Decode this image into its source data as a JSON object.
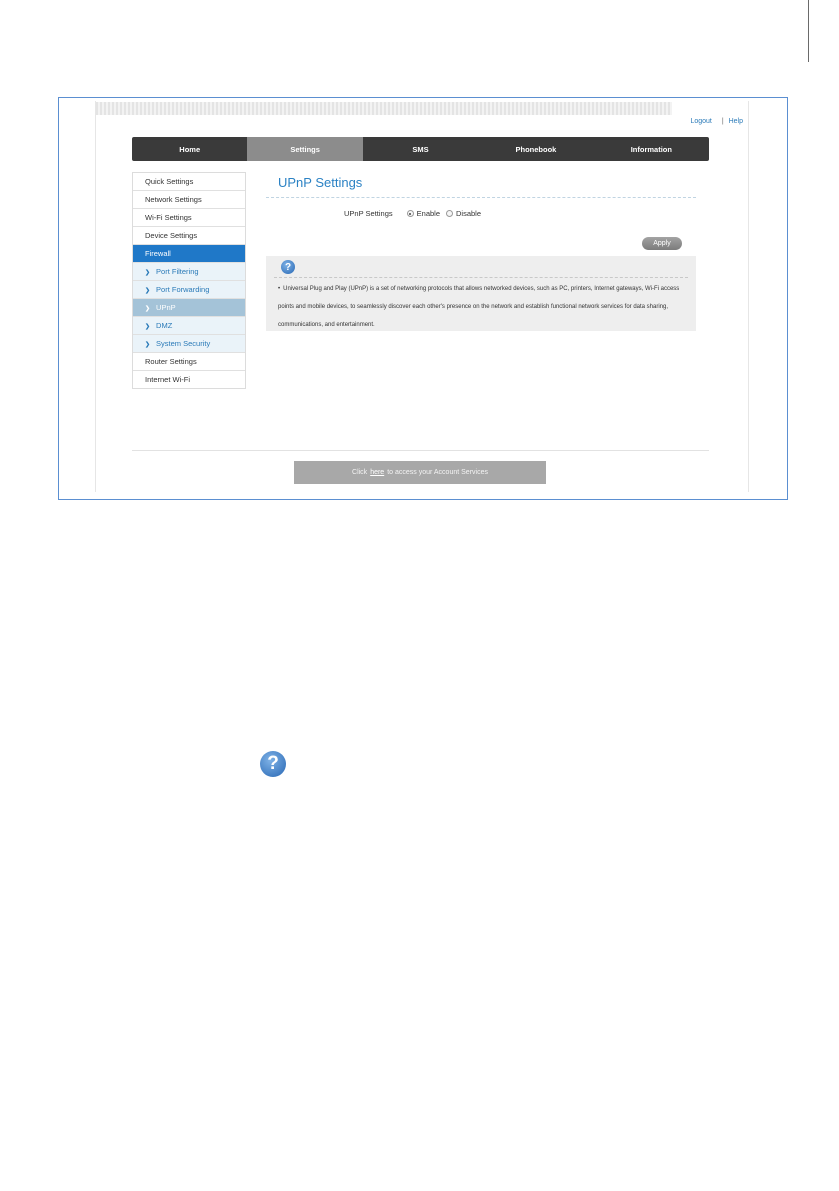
{
  "top_links": {
    "logout": "Logout",
    "separator": "|",
    "help": "Help"
  },
  "nav": {
    "tabs": [
      {
        "label": "Home"
      },
      {
        "label": "Settings",
        "active": true
      },
      {
        "label": "SMS"
      },
      {
        "label": "Phonebook"
      },
      {
        "label": "Information"
      }
    ]
  },
  "sidebar": {
    "items": [
      {
        "label": "Quick Settings"
      },
      {
        "label": "Network Settings"
      },
      {
        "label": "Wi-Fi Settings"
      },
      {
        "label": "Device Settings"
      },
      {
        "label": "Firewall",
        "group_active": true
      },
      {
        "label": "Port Filtering",
        "sub": true
      },
      {
        "label": "Port Forwarding",
        "sub": true
      },
      {
        "label": "UPnP",
        "sub": true,
        "active": true
      },
      {
        "label": "DMZ",
        "sub": true
      },
      {
        "label": "System Security",
        "sub": true
      },
      {
        "label": "Router Settings"
      },
      {
        "label": "Internet Wi-Fi"
      }
    ]
  },
  "content": {
    "title": "UPnP Settings",
    "form": {
      "label": "UPnP Settings",
      "options": [
        {
          "label": "Enable",
          "selected": true
        },
        {
          "label": "Disable",
          "selected": false
        }
      ]
    },
    "apply_label": "Apply",
    "help": {
      "icon_glyph": "?",
      "bullet": "•",
      "text": "Universal Plug and Play (UPnP) is a set of networking protocols that allows networked devices, such as PC, printers, Internet gateways, Wi-Fi access points and mobile devices, to seamlessly discover each other's presence on the network and establish functional network services for data sharing, communications, and entertainment."
    }
  },
  "footer": {
    "prefix": "Click",
    "link": "here",
    "suffix": "to access your Account Services"
  },
  "standalone_icon_glyph": "?",
  "colors": {
    "accent": "#2b82c4",
    "firewall_group": "#1f78c8",
    "nav_bg": "#3a3a3a",
    "nav_active": "#8c8c8c"
  }
}
